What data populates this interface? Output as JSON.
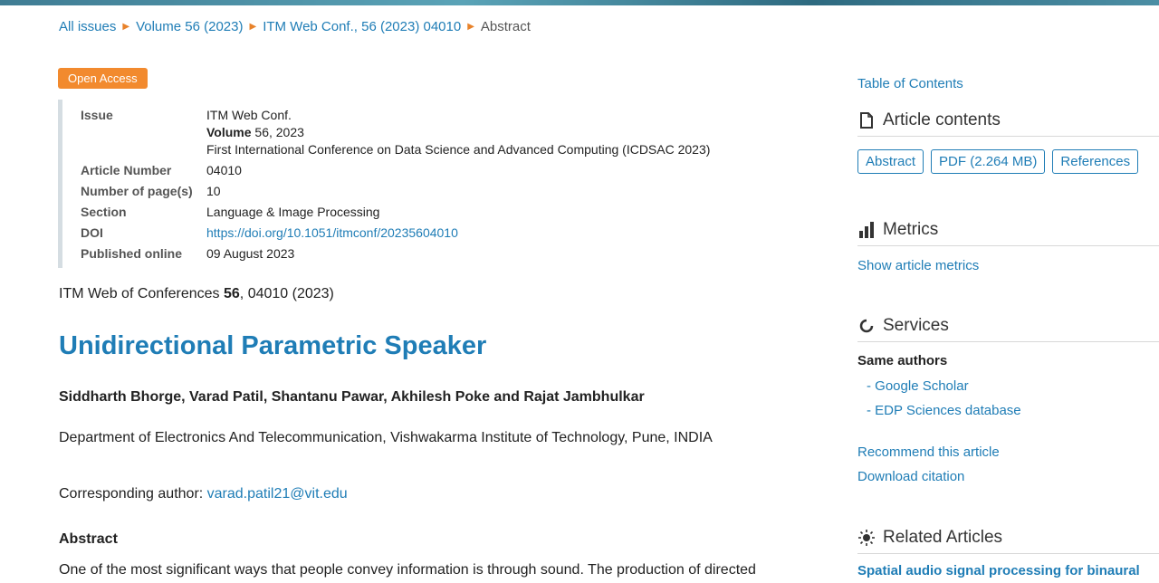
{
  "breadcrumb": {
    "items": [
      "All issues",
      "Volume 56 (2023)",
      "ITM Web Conf., 56 (2023) 04010"
    ],
    "current": "Abstract"
  },
  "badge": "Open Access",
  "meta": {
    "issue_label": "Issue",
    "issue_line1": "ITM Web Conf.",
    "issue_vol_bold": "Volume",
    "issue_vol_rest": " 56, 2023",
    "issue_line3": "First International Conference on Data Science and Advanced Computing (ICDSAC 2023)",
    "article_number_label": "Article Number",
    "article_number": "04010",
    "pages_label": "Number of page(s)",
    "pages": "10",
    "section_label": "Section",
    "section": "Language & Image Processing",
    "doi_label": "DOI",
    "doi": "https://doi.org/10.1051/itmconf/20235604010",
    "published_label": "Published online",
    "published": "09 August 2023"
  },
  "citation": {
    "journal": "ITM Web of Conferences ",
    "volume": "56",
    "rest": ", 04010 (2023)"
  },
  "article": {
    "title": "Unidirectional Parametric Speaker",
    "authors": "Siddharth Bhorge, Varad Patil, Shantanu Pawar, Akhilesh Poke and Rajat Jambhulkar",
    "affiliation": "Department of Electronics And Telecommunication, Vishwakarma Institute of Technology, Pune, INDIA",
    "corresponding_label": "Corresponding author: ",
    "corresponding_email": "varad.patil21@vit.edu",
    "abstract_heading": "Abstract",
    "abstract_text": "One of the most significant ways that people convey information is through sound. The production of directed"
  },
  "sidebar": {
    "toc": "Table of Contents",
    "article_contents": "Article contents",
    "buttons": [
      "Abstract",
      "PDF (2.264 MB)",
      "References"
    ],
    "metrics": "Metrics",
    "show_metrics": "Show article metrics",
    "services": "Services",
    "same_authors": "Same authors",
    "google_scholar": "- Google Scholar",
    "edp": "- EDP Sciences database",
    "recommend": "Recommend this article",
    "download": "Download citation",
    "related": "Related Articles",
    "related_first": "Spatial audio signal processing for binaural"
  }
}
